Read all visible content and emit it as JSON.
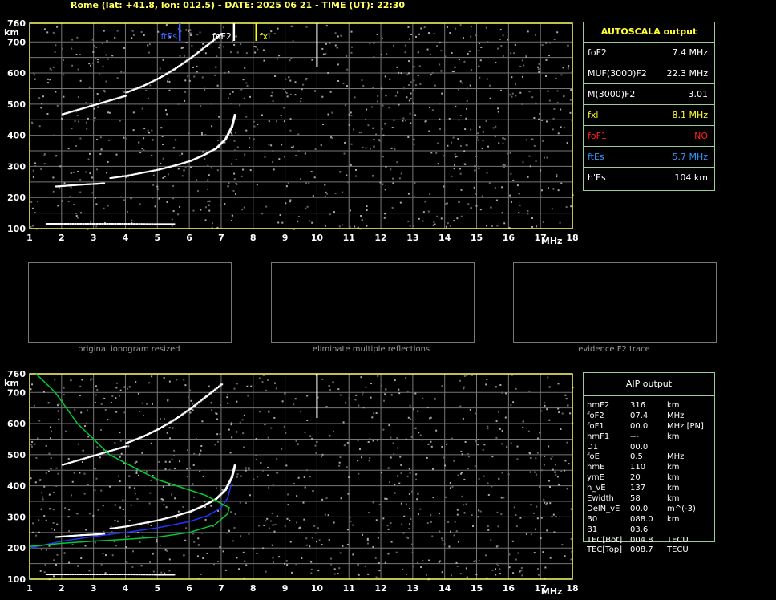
{
  "header": "Rome (lat: +41.8, lon: 012.5) - DATE: 2025 06 21 - TIME (UT): 22:30",
  "colors": {
    "grid": "#777777",
    "frame": "#ffff66",
    "es": "#3366ff",
    "fxi": "#ffff00",
    "fof1": "#ff2222",
    "green": "#00cc33",
    "blue": "#2233ff"
  },
  "axes": {
    "x_ticks": [
      "1",
      "2",
      "3",
      "4",
      "5",
      "6",
      "7",
      "8",
      "9",
      "10",
      "11",
      "12",
      "13",
      "14",
      "15",
      "16",
      "17",
      "18"
    ],
    "x_unit": "MHz",
    "y_ticks": [
      "100",
      "200",
      "300",
      "400",
      "500",
      "600",
      "700",
      "760"
    ],
    "y_unit": "km"
  },
  "top_markers": {
    "ftes": "ftEs",
    "fof2": "foF2",
    "fxi": "fxl"
  },
  "autoscala": {
    "title": "AUTOSCALA output",
    "rows": [
      {
        "label": "foF2",
        "value": "7.4 MHz",
        "color": "#ffffff"
      },
      {
        "label": "MUF(3000)F2",
        "value": "22.3 MHz",
        "color": "#ffffff"
      },
      {
        "label": "M(3000)F2",
        "value": "3.01",
        "color": "#ffffff"
      },
      {
        "label": "fxl",
        "value": "8.1 MHz",
        "color": "#ffff33"
      },
      {
        "label": "foF1",
        "value": "NO",
        "color": "#ff2222"
      },
      {
        "label": "ftEs",
        "value": "5.7 MHz",
        "color": "#3399ff"
      },
      {
        "label": "h'Es",
        "value": "104     km",
        "color": "#ffffff"
      }
    ]
  },
  "thumbnails": {
    "captions": [
      "original ionogram resized",
      "eliminate multiple reflections",
      "evidence F2 trace"
    ]
  },
  "aip": {
    "title": "AIP output",
    "rows": [
      [
        "hmF2",
        "316",
        "km"
      ],
      [
        "foF2",
        "07.4",
        "MHz"
      ],
      [
        "foF1",
        "00.0",
        "MHz    [PN]"
      ],
      [
        "hmF1",
        "---",
        "km"
      ],
      [
        "D1",
        "00.0",
        ""
      ],
      [
        "foE",
        "0.5",
        "MHz"
      ],
      [
        "hmE",
        "110",
        "km"
      ],
      [
        "ymE",
        "20",
        "km"
      ],
      [
        "h_vE",
        "137",
        "km"
      ],
      [
        "Ewidth",
        "58",
        "km"
      ],
      [
        "DelN_vE",
        "00.0",
        "m^(-3)"
      ],
      [
        "B0",
        "088.0",
        "km"
      ],
      [
        "B1",
        "03.6",
        ""
      ],
      [
        "TEC[Bot]",
        "004.8",
        "TECU"
      ],
      [
        "TEC[Top]",
        "008.7",
        "TECU"
      ]
    ]
  },
  "chart_data": [
    {
      "type": "scatter",
      "title": "Rome (lat: +41.8, lon: 012.5) - DATE: 2025 06 21 - TIME (UT): 22:30",
      "xlabel": "MHz",
      "ylabel": "km",
      "xlim": [
        1,
        18
      ],
      "ylim": [
        100,
        760
      ],
      "grid": true,
      "series": [
        {
          "name": "F2 trace",
          "x": [
            3.5,
            4,
            4.5,
            5,
            5.5,
            6,
            6.4,
            6.8,
            7.1,
            7.3,
            7.4
          ],
          "y": [
            265,
            272,
            282,
            292,
            305,
            320,
            338,
            360,
            390,
            430,
            470
          ]
        },
        {
          "x": [
            1.8,
            2.2,
            2.6,
            3.0,
            3.3
          ],
          "y": [
            238,
            241,
            244,
            246,
            248
          ]
        },
        {
          "x": [
            2,
            2.5,
            3,
            3.5,
            4
          ],
          "y": [
            470,
            485,
            500,
            515,
            530
          ]
        },
        {
          "x": [
            4,
            4.5,
            5,
            5.5,
            6,
            6.5,
            7
          ],
          "y": [
            540,
            560,
            585,
            615,
            650,
            690,
            730
          ]
        },
        {
          "x": [
            1.5,
            2,
            3,
            4,
            5,
            5.5
          ],
          "y": [
            118,
            118,
            118,
            118,
            117,
            117
          ]
        }
      ],
      "markers": [
        {
          "name": "ftEs",
          "x": 5.7
        },
        {
          "name": "foF2",
          "x": 7.4
        },
        {
          "name": "fxl",
          "x": 8.1
        }
      ]
    },
    {
      "type": "line",
      "title": "AIP output",
      "xlabel": "MHz",
      "ylabel": "km",
      "xlim": [
        1,
        18
      ],
      "ylim": [
        100,
        760
      ],
      "series": [
        {
          "x": [
            1.0,
            2,
            3,
            4,
            5,
            6,
            6.6,
            7.0,
            7.2,
            7.3
          ],
          "y": [
            200,
            222,
            237,
            250,
            265,
            285,
            305,
            330,
            360,
            400
          ]
        },
        {
          "x": [
            1.0,
            2,
            3,
            4,
            5,
            6,
            6.8,
            7.2,
            7.25,
            6.5,
            5,
            3.5,
            2.5,
            1.8,
            1.2
          ],
          "y": [
            205,
            215,
            222,
            228,
            235,
            250,
            275,
            310,
            330,
            370,
            420,
            500,
            600,
            700,
            760
          ]
        }
      ]
    }
  ]
}
